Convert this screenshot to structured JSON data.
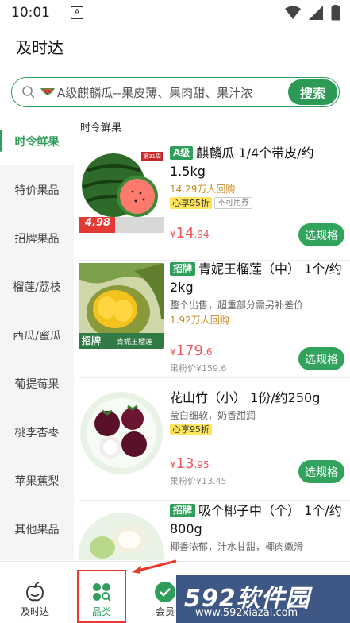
{
  "status_bar": {
    "time": "10:01",
    "a_label": "A"
  },
  "app": {
    "title": "及时达"
  },
  "search": {
    "placeholder_text": "A级麒麟瓜--果皮薄、果肉甜、果汁浓",
    "button_label": "搜索"
  },
  "sidebar": {
    "items": [
      {
        "label": "时令鲜果",
        "active": true
      },
      {
        "label": "特价果品"
      },
      {
        "label": "招牌果品"
      },
      {
        "label": "榴莲/荔枝"
      },
      {
        "label": "西瓜/蜜瓜"
      },
      {
        "label": "葡提莓果"
      },
      {
        "label": "桃李杏枣"
      },
      {
        "label": "苹果蕉梨"
      },
      {
        "label": "其他果品"
      }
    ]
  },
  "section": {
    "title": "时令鲜果"
  },
  "products": [
    {
      "tag": "A级",
      "name": "麒麟瓜 1/4个带皮/约1.5kg",
      "buyers": "14.29万人回购",
      "discount": "心享95折",
      "coupon_note": "不可用券",
      "price_cur": "¥",
      "price_int": "14",
      "price_dec": ".94",
      "button": "选规格",
      "image_price_badge": "4.98",
      "image_corner_badge": "第31周"
    },
    {
      "tag": "招牌",
      "name": "青妮王榴莲（中） 1个/约2kg",
      "desc": "整个出售，超重部分需另补差价",
      "buyers": "1.92万人回购",
      "price_cur": "¥",
      "price_int": "179",
      "price_dec": ".6",
      "orig_price": "果粉价¥159.6",
      "button": "选规格",
      "image_badge": "招牌",
      "image_caption": "青妮王榴莲"
    },
    {
      "name": "花山竹（小） 1份/约250g",
      "desc": "莹白细软，奶香甜润",
      "discount": "心享95折",
      "price_cur": "¥",
      "price_int": "13",
      "price_dec": ".95",
      "orig_price": "果粉价¥13.45",
      "button": "选规格"
    },
    {
      "tag": "招牌",
      "name": "吸个椰子中（个） 1个/约800g",
      "desc": "椰香浓郁，汁水甘甜，椰肉嫩滑"
    }
  ],
  "bottom_nav": {
    "items": [
      {
        "label": "及时达",
        "icon": "apple-icon"
      },
      {
        "label": "品类",
        "icon": "category-icon"
      },
      {
        "label": "会员",
        "icon": "member-icon"
      }
    ]
  },
  "watermark": {
    "brand": "592软件园",
    "url": "www.592xiazai.com"
  },
  "colors": {
    "accent": "#2f9e5b",
    "price": "#f0565e",
    "highlight": "#e8392c"
  }
}
